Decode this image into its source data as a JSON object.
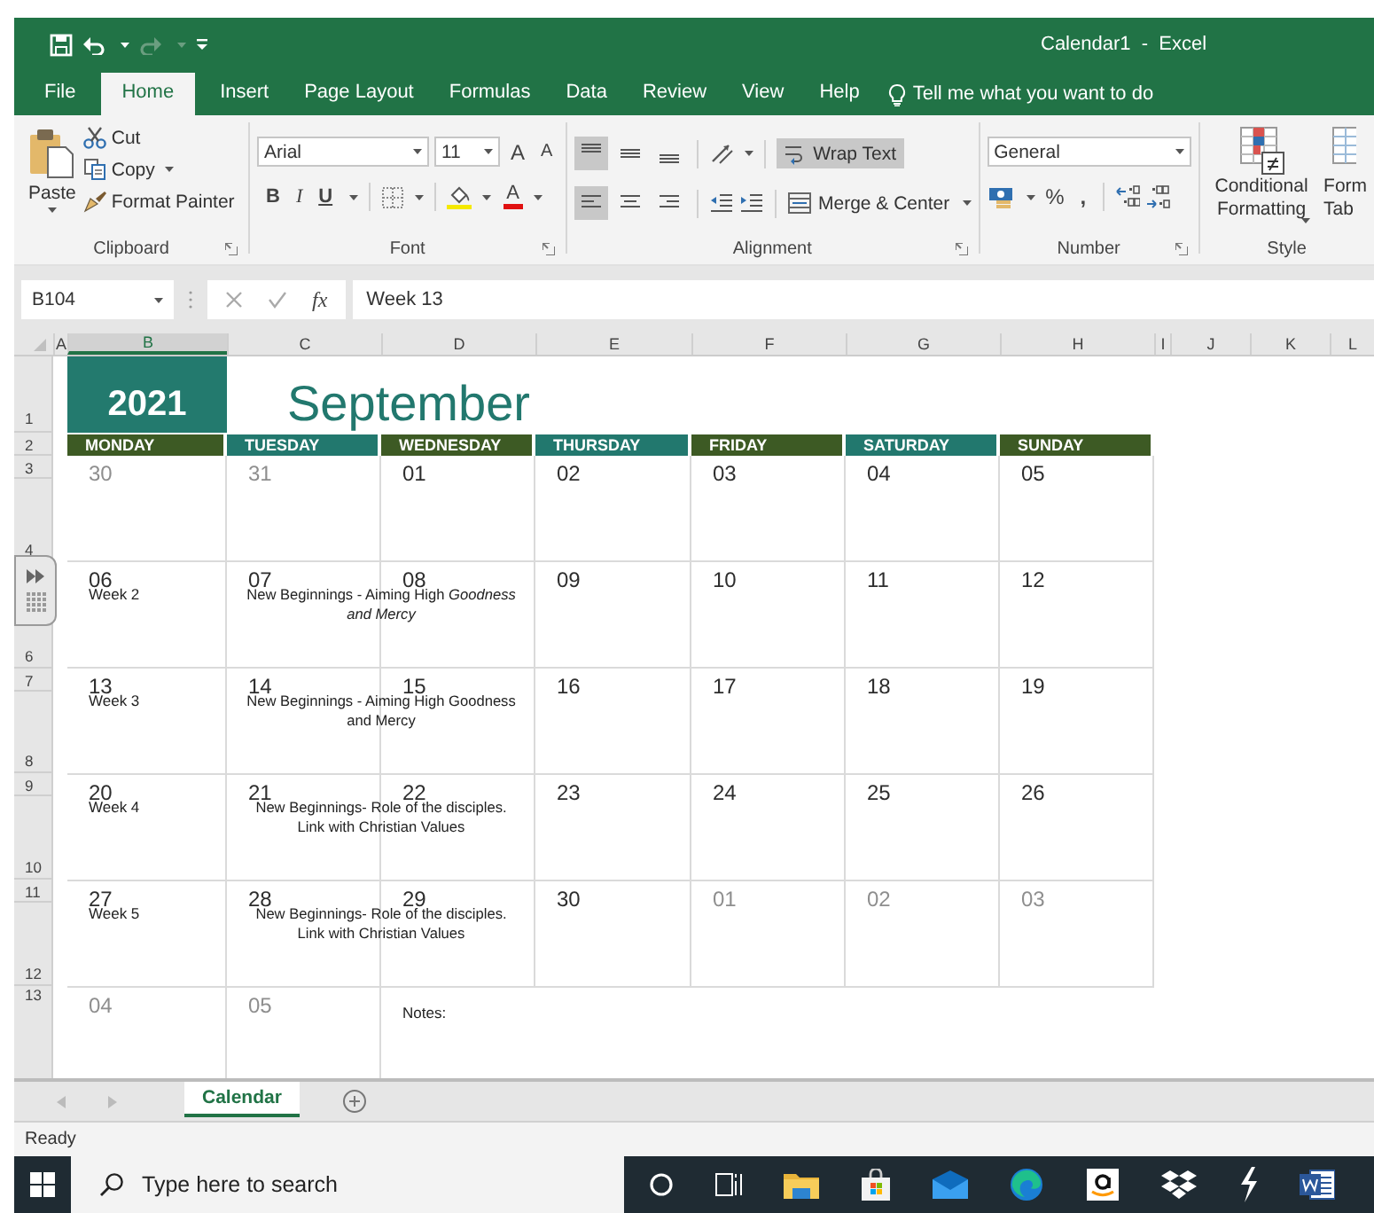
{
  "window": {
    "title": "Calendar1  -  Excel"
  },
  "ribbon_tabs": [
    {
      "label": "File",
      "selected": false
    },
    {
      "label": "Home",
      "selected": true
    },
    {
      "label": "Insert",
      "selected": false
    },
    {
      "label": "Page Layout",
      "selected": false
    },
    {
      "label": "Formulas",
      "selected": false
    },
    {
      "label": "Data",
      "selected": false
    },
    {
      "label": "Review",
      "selected": false
    },
    {
      "label": "View",
      "selected": false
    },
    {
      "label": "Help",
      "selected": false
    }
  ],
  "tell_me": "Tell me what you want to do",
  "ribbon": {
    "clipboard": {
      "paste": "Paste",
      "cut": "Cut",
      "copy": "Copy",
      "format_painter": "Format Painter",
      "label": "Clipboard"
    },
    "font": {
      "font_name": "Arial",
      "font_size": "11",
      "grow": "A",
      "shrink": "A",
      "bold": "B",
      "italic": "I",
      "underline": "U",
      "font_color": "A",
      "label": "Font"
    },
    "alignment": {
      "vertical_align": [
        {
          "selected": true
        },
        {
          "selected": false
        },
        {
          "selected": false
        }
      ],
      "horizontal_align": [
        {
          "selected": true
        },
        {
          "selected": false
        },
        {
          "selected": false
        }
      ],
      "wrap_text": {
        "label": "Wrap Text",
        "selected": true
      },
      "merge_center": "Merge & Center",
      "label": "Alignment"
    },
    "number": {
      "format": "General",
      "percent": "%",
      "comma": ",",
      "label": "Number"
    },
    "styles": {
      "conditional_formatting": "Conditional Formatting",
      "format_as_table": [
        "Form",
        "Tab"
      ],
      "label": "Style"
    }
  },
  "formula_bar": {
    "name_box": "B104",
    "fx": "fx",
    "formula": "Week 13"
  },
  "column_headers": [
    {
      "label": "A",
      "selected": false
    },
    {
      "label": "B",
      "selected": true
    },
    {
      "label": "C",
      "selected": false
    },
    {
      "label": "D",
      "selected": false
    },
    {
      "label": "E",
      "selected": false
    },
    {
      "label": "F",
      "selected": false
    },
    {
      "label": "G",
      "selected": false
    },
    {
      "label": "H",
      "selected": false
    },
    {
      "label": "I",
      "selected": false
    },
    {
      "label": "J",
      "selected": false
    },
    {
      "label": "K",
      "selected": false
    },
    {
      "label": "L",
      "selected": false
    }
  ],
  "row_headers": [
    {
      "label": "1",
      "kind": "title"
    },
    {
      "label": "2",
      "kind": "days"
    },
    {
      "label": "3",
      "kind": "date"
    },
    {
      "label": "4",
      "kind": "body"
    },
    {
      "kind": "date"
    },
    {
      "label": "6",
      "kind": "body"
    },
    {
      "label": "7",
      "kind": "date"
    },
    {
      "label": "8",
      "kind": "body"
    },
    {
      "label": "9",
      "kind": "date"
    },
    {
      "label": "10",
      "kind": "body"
    },
    {
      "label": "11",
      "kind": "date"
    },
    {
      "label": "12",
      "kind": "body"
    },
    {
      "label": "13",
      "kind": "last"
    }
  ],
  "calendar": {
    "year": "2021",
    "month": "September",
    "day_headers": [
      {
        "label": "MONDAY",
        "color": "#3d5a24"
      },
      {
        "label": "TUESDAY",
        "color": "#22786e"
      },
      {
        "label": "WEDNESDAY",
        "color": "#3d5a24"
      },
      {
        "label": "THURSDAY",
        "color": "#22786e"
      },
      {
        "label": "FRIDAY",
        "color": "#3d5a24"
      },
      {
        "label": "SATURDAY",
        "color": "#22786e"
      },
      {
        "label": "SUNDAY",
        "color": "#3d5a24"
      }
    ],
    "weeks": [
      {
        "days": [
          {
            "date": "30",
            "muted": true
          },
          {
            "date": "31",
            "muted": true
          },
          {
            "date": "01",
            "muted": false
          },
          {
            "date": "02",
            "muted": false
          },
          {
            "date": "03",
            "muted": false
          },
          {
            "date": "04",
            "muted": false
          },
          {
            "date": "05",
            "muted": false
          }
        ]
      },
      {
        "week_label": "Week 2",
        "note": "New Beginnings - Aiming High *Goodness and Mercy*",
        "days": [
          {
            "date": "06",
            "muted": false
          },
          {
            "date": "07",
            "muted": false
          },
          {
            "date": "08",
            "muted": false
          },
          {
            "date": "09",
            "muted": false
          },
          {
            "date": "10",
            "muted": false
          },
          {
            "date": "11",
            "muted": false
          },
          {
            "date": "12",
            "muted": false
          }
        ]
      },
      {
        "week_label": "Week 3",
        "note": "New Beginnings - Aiming High Goodness and Mercy",
        "days": [
          {
            "date": "13",
            "muted": false
          },
          {
            "date": "14",
            "muted": false
          },
          {
            "date": "15",
            "muted": false
          },
          {
            "date": "16",
            "muted": false
          },
          {
            "date": "17",
            "muted": false
          },
          {
            "date": "18",
            "muted": false
          },
          {
            "date": "19",
            "muted": false
          }
        ]
      },
      {
        "week_label": "Week 4",
        "note": "New Beginnings- Role of the disciples. Link with Christian Values",
        "days": [
          {
            "date": "20",
            "muted": false
          },
          {
            "date": "21",
            "muted": false
          },
          {
            "date": "22",
            "muted": false
          },
          {
            "date": "23",
            "muted": false
          },
          {
            "date": "24",
            "muted": false
          },
          {
            "date": "25",
            "muted": false
          },
          {
            "date": "26",
            "muted": false
          }
        ]
      },
      {
        "week_label": "Week 5",
        "note": "New Beginnings- Role of the disciples. Link with Christian Values",
        "days": [
          {
            "date": "27",
            "muted": false
          },
          {
            "date": "28",
            "muted": false
          },
          {
            "date": "29",
            "muted": false
          },
          {
            "date": "30",
            "muted": false
          },
          {
            "date": "01",
            "muted": true
          },
          {
            "date": "02",
            "muted": true
          },
          {
            "date": "03",
            "muted": true
          }
        ]
      }
    ],
    "last_row": {
      "days": [
        {
          "date": "04",
          "muted": true
        },
        {
          "date": "05",
          "muted": true
        }
      ],
      "notes_label": "Notes:"
    }
  },
  "sheet_tabs": [
    {
      "label": "Calendar",
      "selected": true
    }
  ],
  "status_bar": {
    "text": "Ready"
  },
  "taskbar": {
    "search_placeholder": "Type here to search"
  }
}
